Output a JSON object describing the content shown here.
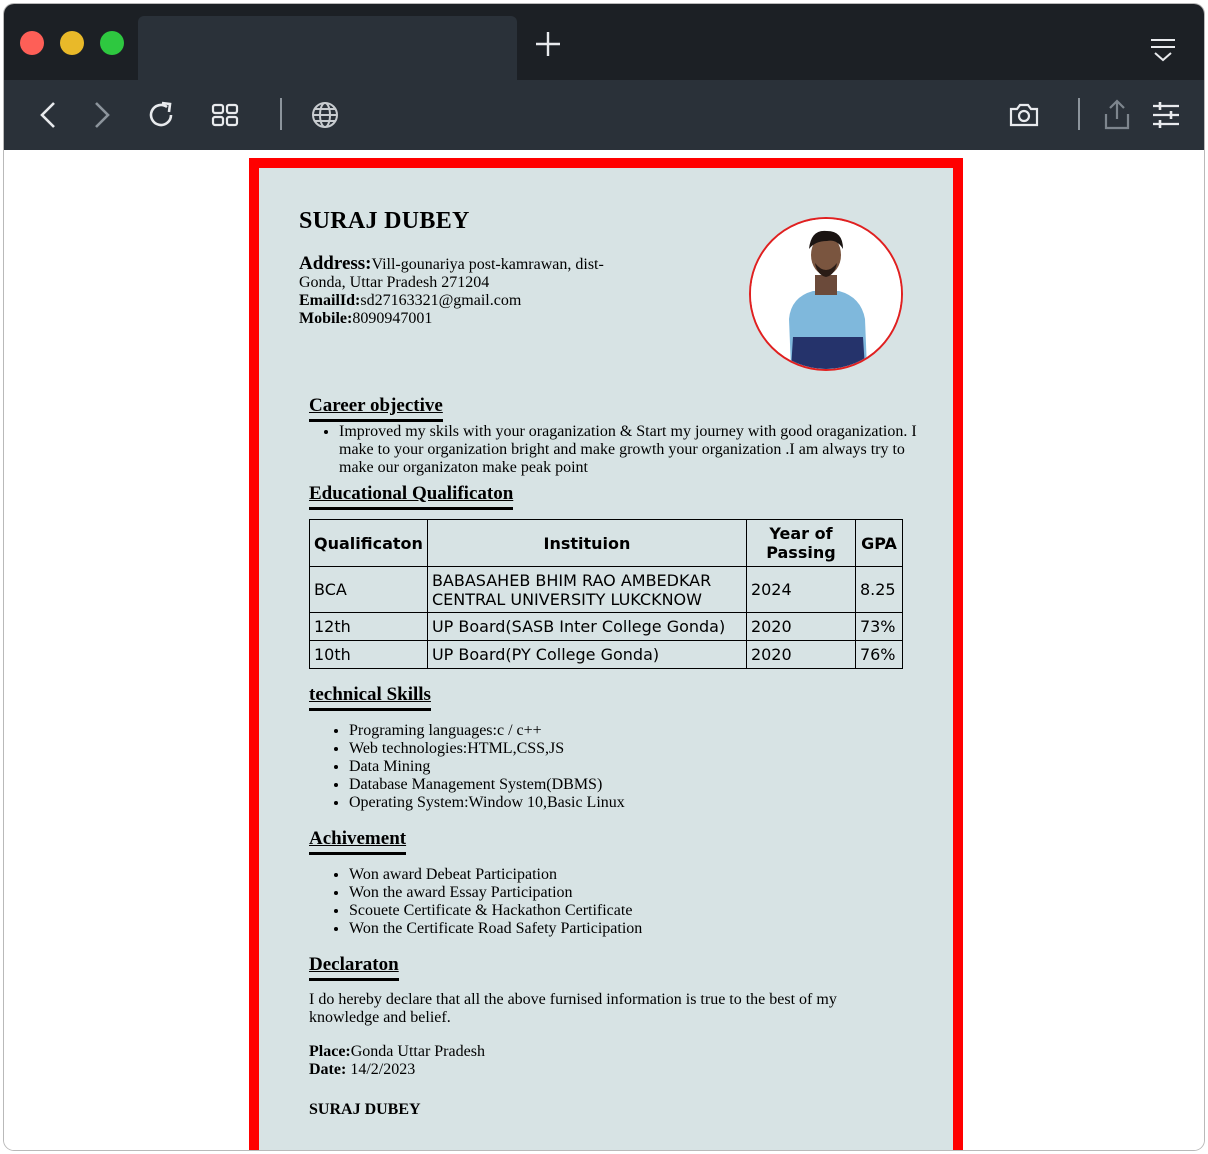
{
  "browser": {
    "window_controls": [
      "close",
      "minimize",
      "maximize"
    ],
    "tab_title": "",
    "toolbar_icons": [
      "back-icon",
      "forward-icon",
      "reload-icon",
      "tabs-grid-icon",
      "globe-icon",
      "camera-icon",
      "share-icon",
      "settings-sliders-icon"
    ]
  },
  "resume": {
    "name": "SURAJ DUBEY",
    "address_label": "Address:",
    "address_value": "Vill-gounariya post-kamrawan, dist-Gonda, Uttar Pradesh 271204",
    "email_label": "EmailId:",
    "email_value": "sd27163321@gmail.com",
    "mobile_label": "Mobile:",
    "mobile_value": "8090947001",
    "career_heading": "Career objective",
    "career_text": "Improved my skils with your oraganization & Start my journey with good oraganization. I make to your organization bright and make growth your organization .I am always try to make our organizaton make peak point",
    "education_heading": "Educational Qualificaton",
    "education_table": {
      "headers": [
        "Qualificaton",
        "Instituion",
        "Year of Passing",
        "GPA"
      ],
      "rows": [
        [
          "BCA",
          "BABASAHEB BHIM RAO AMBEDKAR CENTRAL UNIVERSITY LUKCKNOW",
          "2024",
          "8.25"
        ],
        [
          "12th",
          "UP Board(SASB Inter College Gonda)",
          "2020",
          "73%"
        ],
        [
          "10th",
          "UP Board(PY College Gonda)",
          "2020",
          "76%"
        ]
      ]
    },
    "skills_heading": "technical Skills",
    "skills": [
      "Programing languages:c / c++",
      "Web technologies:HTML,CSS,JS",
      "Data Mining",
      "Database Management System(DBMS)",
      "Operating System:Window 10,Basic Linux"
    ],
    "achievement_heading": "Achivement",
    "achievements": [
      "Won award Debeat Participation",
      "Won the award Essay Participation",
      "Scouete Certificate & Hackathon Certificate",
      "Won the Certificate Road Safety Participation"
    ],
    "declaration_heading": "Declaraton",
    "declaration_text": "I do hereby declare that all the above furnised information is true to the best of my knowledge and belief.",
    "place_label": "Place:",
    "place_value": "Gonda Uttar Pradesh",
    "date_label": "Date:",
    "date_value": " 14/2/2023",
    "signature": "SURAJ DUBEY"
  },
  "colors": {
    "border": "#ff0000",
    "paper": "#d7e3e4",
    "titlebar": "#1c2025",
    "toolbar": "#2a3139"
  }
}
